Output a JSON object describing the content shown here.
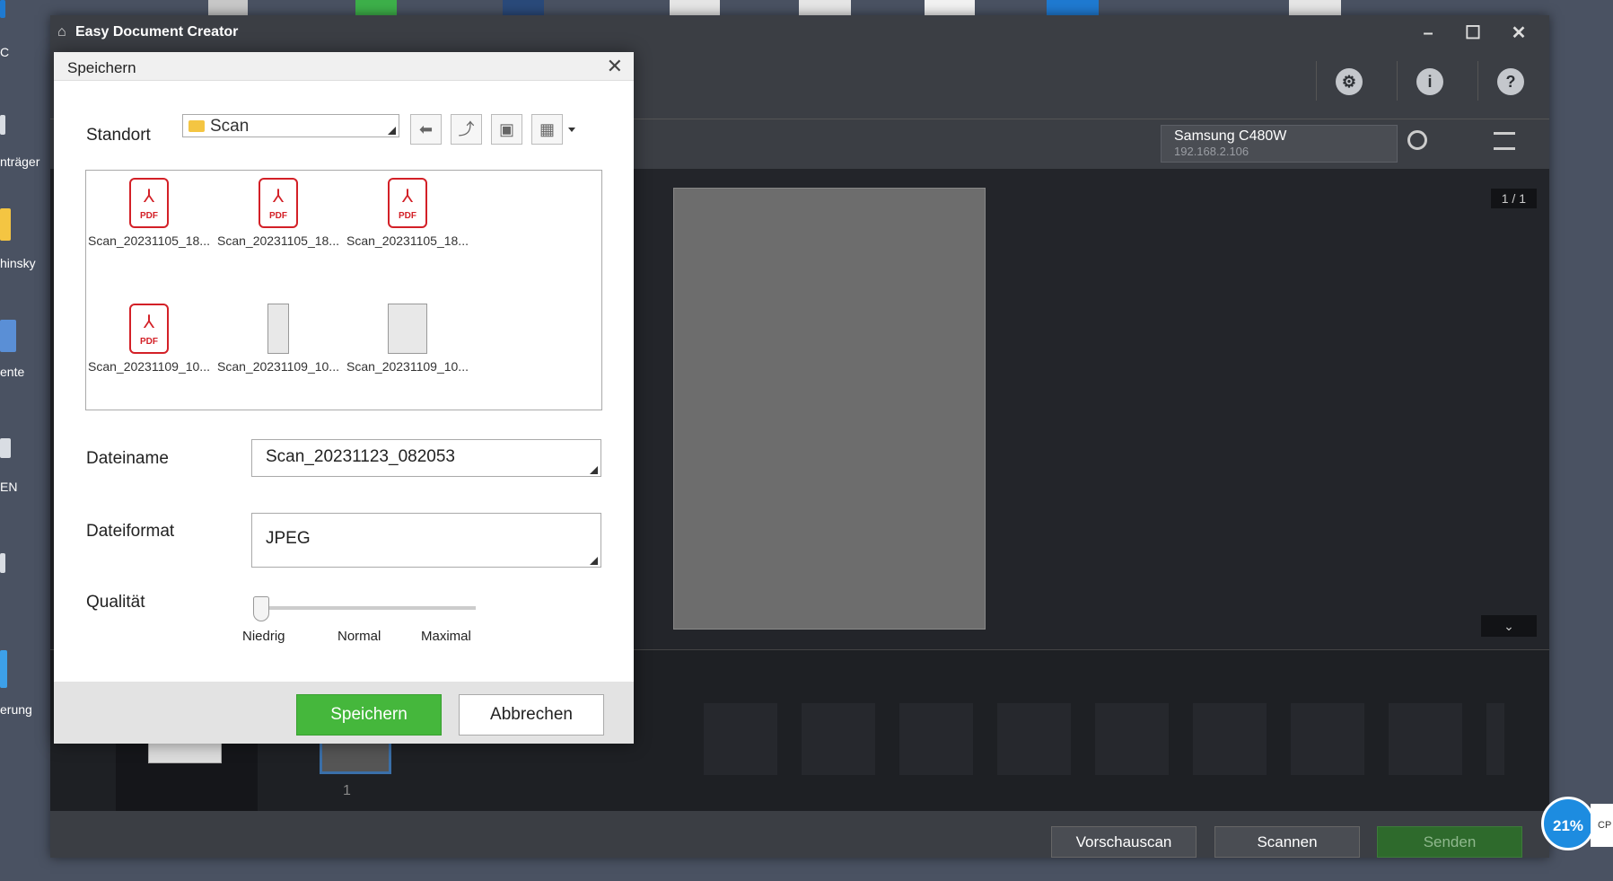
{
  "desktop": {
    "labels": [
      "C",
      "nträger",
      "hinsky",
      "ente",
      "EN",
      "erung"
    ]
  },
  "app": {
    "title": "Easy Document Creator",
    "device": {
      "name": "Samsung C480W",
      "ip": "192.168.2.106"
    },
    "pager": "1 / 1",
    "thumb_number": "1",
    "buttons": {
      "preview": "Vorschauscan",
      "scan": "Scannen",
      "send": "Senden"
    }
  },
  "overlay_percent": "21%",
  "overlay_side": "CP",
  "dialog": {
    "title": "Speichern",
    "location_label": "Standort",
    "location_value": "Scan",
    "files": [
      {
        "name": "Scan_20231105_18...",
        "type": "pdf"
      },
      {
        "name": "Scan_20231105_18...",
        "type": "pdf"
      },
      {
        "name": "Scan_20231105_18...",
        "type": "pdf"
      },
      {
        "name": "Scan_20231109_10...",
        "type": "pdf"
      },
      {
        "name": "Scan_20231109_10...",
        "type": "image"
      },
      {
        "name": "Scan_20231109_10...",
        "type": "image"
      }
    ],
    "pdf_badge": "PDF",
    "filename_label": "Dateiname",
    "filename_value": "Scan_20231123_082053",
    "format_label": "Dateiformat",
    "format_value": "JPEG",
    "quality_label": "Qualität",
    "quality_value": 0,
    "quality_levels": {
      "low": "Niedrig",
      "normal": "Normal",
      "max": "Maximal"
    },
    "save_button": "Speichern",
    "cancel_button": "Abbrechen"
  }
}
